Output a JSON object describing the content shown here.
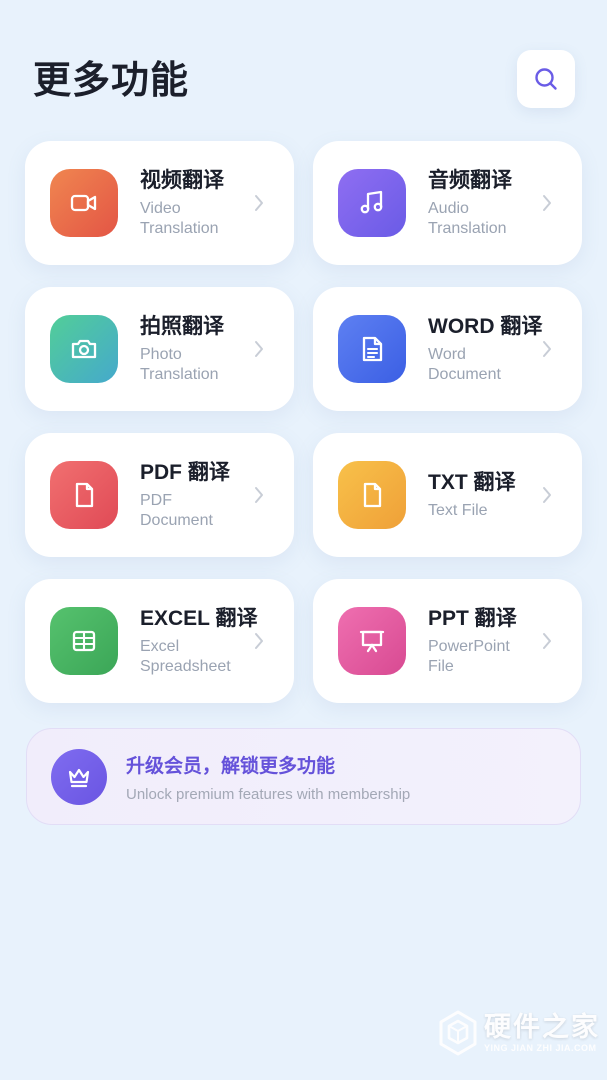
{
  "header": {
    "title": "更多功能",
    "search_icon": "search-icon"
  },
  "features": [
    {
      "title": "视频翻译",
      "subtitle": "Video\nTranslation",
      "icon": "video-camera-icon",
      "colors": [
        "#F07F4F",
        "#E35A45"
      ]
    },
    {
      "title": "音频翻译",
      "subtitle": "Audio\nTranslation",
      "icon": "music-note-icon",
      "colors": [
        "#8C6BF1",
        "#6C5CE7"
      ]
    },
    {
      "title": "拍照翻译",
      "subtitle": "Photo\nTranslation",
      "icon": "camera-icon",
      "colors": [
        "#4FCB9E",
        "#46AEC8"
      ]
    },
    {
      "title": "WORD 翻译",
      "subtitle": "Word\nDocument",
      "icon": "document-icon",
      "colors": [
        "#5B7BF0",
        "#3E63E6"
      ]
    },
    {
      "title": "PDF 翻译",
      "subtitle": "PDF\nDocument",
      "icon": "file-icon",
      "colors": [
        "#F06A6A",
        "#E24B57"
      ]
    },
    {
      "title": "TXT 翻译",
      "subtitle": "Text File",
      "icon": "file-icon",
      "colors": [
        "#F7BC45",
        "#F0A23A"
      ]
    },
    {
      "title": "EXCEL 翻译",
      "subtitle": "Excel\nSpreadsheet",
      "icon": "table-icon",
      "colors": [
        "#52BF6A",
        "#3EA95A"
      ]
    },
    {
      "title": "PPT 翻译",
      "subtitle": "PowerPoint\nFile",
      "icon": "presentation-icon",
      "colors": [
        "#EE6BAE",
        "#DB4F95"
      ]
    }
  ],
  "banner": {
    "title": "升级会员，解锁更多功能",
    "subtitle": "Unlock premium features with membership",
    "icon": "crown-icon"
  },
  "watermark": {
    "title": "硬件之家",
    "subtitle": "YING JIAN ZHI JIA.COM"
  }
}
